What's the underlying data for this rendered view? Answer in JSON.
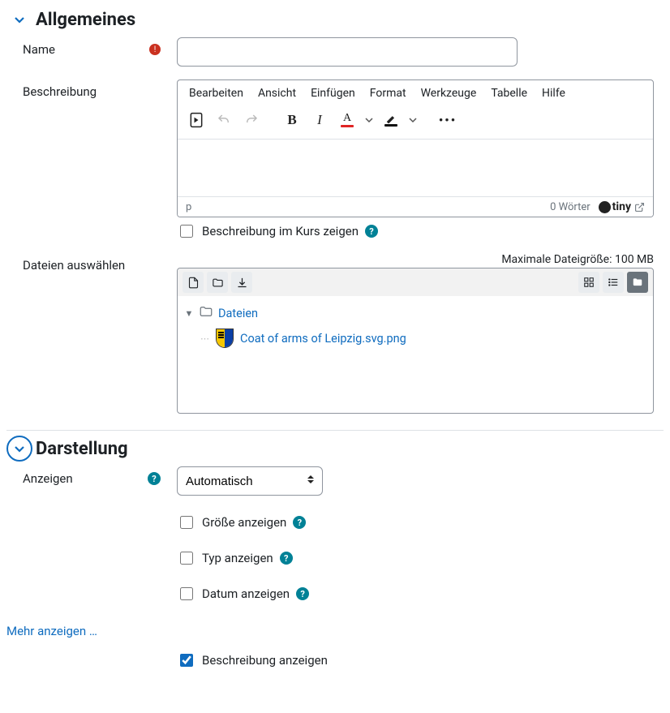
{
  "sections": {
    "general": {
      "title": "Allgemeines"
    },
    "appearance": {
      "title": "Darstellung"
    }
  },
  "general": {
    "name_label": "Name",
    "description_label": "Beschreibung",
    "show_description_label": "Beschreibung im Kurs zeigen",
    "files_label": "Dateien auswählen"
  },
  "editor": {
    "menu": {
      "edit": "Bearbeiten",
      "view": "Ansicht",
      "insert": "Einfügen",
      "format": "Format",
      "tools": "Werkzeuge",
      "table": "Tabelle",
      "help": "Hilfe"
    },
    "status_path": "p",
    "wordcount": "0 Wörter",
    "brand": "tiny"
  },
  "filepicker": {
    "max_size": "Maximale Dateigröße: 100 MB",
    "root_label": "Dateien",
    "file_label": "Coat of arms of Leipzig.svg.png"
  },
  "appearance": {
    "display_label": "Anzeigen",
    "display_options": {
      "auto": "Automatisch"
    },
    "show_size": "Größe anzeigen",
    "show_type": "Typ anzeigen",
    "show_date": "Datum anzeigen",
    "show_description": "Beschreibung anzeigen"
  },
  "links": {
    "show_more": "Mehr anzeigen …"
  }
}
